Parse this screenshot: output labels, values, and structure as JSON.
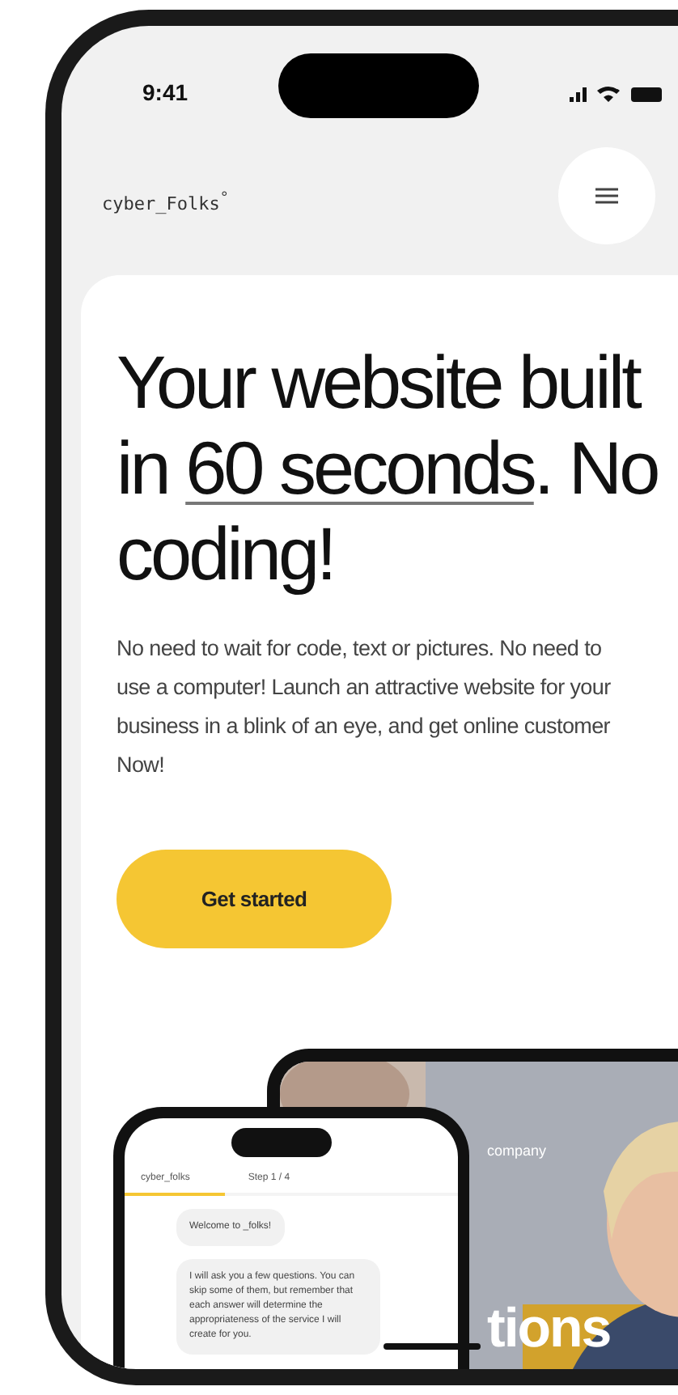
{
  "status_bar": {
    "time": "9:41"
  },
  "header": {
    "logo": "cyber_Folks$^{°}$"
  },
  "hero": {
    "headline": {
      "before": "Your website built in",
      "highlight": "60 seconds",
      "after": ". No coding!"
    },
    "body": "No need to wait for code, text or pictures. No need to use a computer! Launch an attractive website for your business in a blink of an eye, and get online customer Now!",
    "button": "Get started"
  },
  "showcase": {
    "tablet": {
      "caption": "company",
      "title": "tions"
    },
    "phone": {
      "logo": "cyber_folks",
      "step": "Step 1 / 4",
      "progress": {
        "level": 0.3
      },
      "messages": [
        "Welcome to _folks!",
        "I will ask you a few questions. You can skip some of them, but remember that each answer will determine the appropriateness of the service I will create for you."
      ]
    }
  }
}
